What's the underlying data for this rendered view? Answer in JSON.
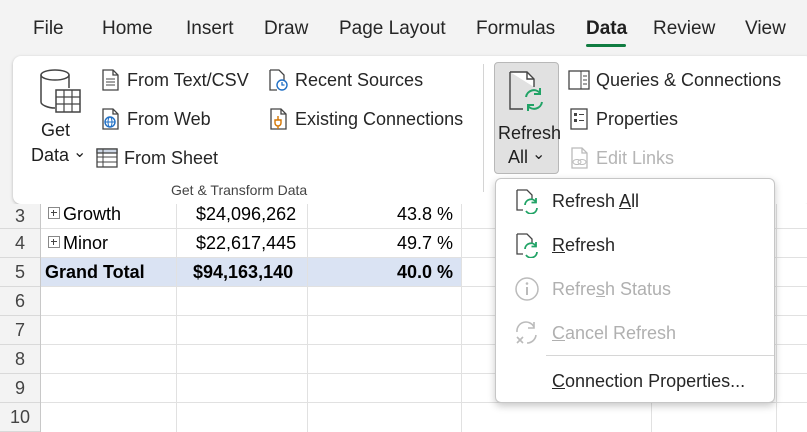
{
  "menu": {
    "tabs": [
      {
        "label": "File"
      },
      {
        "label": "Home"
      },
      {
        "label": "Insert"
      },
      {
        "label": "Draw"
      },
      {
        "label": "Page Layout"
      },
      {
        "label": "Formulas"
      },
      {
        "label": "Data"
      },
      {
        "label": "Review"
      },
      {
        "label": "View"
      }
    ],
    "active_tab": "Data"
  },
  "ribbon": {
    "get_data": {
      "line1": "Get",
      "line2": "Data",
      "chevron": "⌄"
    },
    "from_text_csv": "From Text/CSV",
    "from_web": "From Web",
    "from_sheet": "From Sheet",
    "recent_sources": "Recent Sources",
    "existing_connections": "Existing Connections",
    "group_label": "Get & Transform Data",
    "refresh_all": {
      "line1": "Refresh",
      "line2": "All",
      "chevron": "⌄"
    },
    "queries_connections": "Queries & Connections",
    "properties": "Properties",
    "edit_links": "Edit Links"
  },
  "sheet": {
    "row_numbers": [
      "3",
      "4",
      "5",
      "6",
      "7",
      "8",
      "9",
      "10"
    ],
    "rows": [
      {
        "label": "Growth",
        "value": "$24,096,262",
        "pct": "43.8 %"
      },
      {
        "label": "Minor",
        "value": "$22,617,445",
        "pct": "49.7 %"
      }
    ],
    "grand_total": {
      "label": "Grand Total",
      "value": "$94,163,140",
      "pct": "40.0 %"
    }
  },
  "dropdown": {
    "refresh_all": {
      "pre": "Refresh ",
      "key": "A",
      "post": "ll"
    },
    "refresh": {
      "key": "R",
      "post": "efresh"
    },
    "refresh_status": {
      "pre": "Refre",
      "key": "s",
      "post": "h Status"
    },
    "cancel_refresh": {
      "key": "C",
      "post": "ancel Refresh"
    },
    "connection_properties": {
      "key": "C",
      "post": "onnection Properties..."
    }
  },
  "colors": {
    "accent": "#107c41",
    "refresh_green": "#21a366",
    "total_band": "#dae3f3"
  }
}
